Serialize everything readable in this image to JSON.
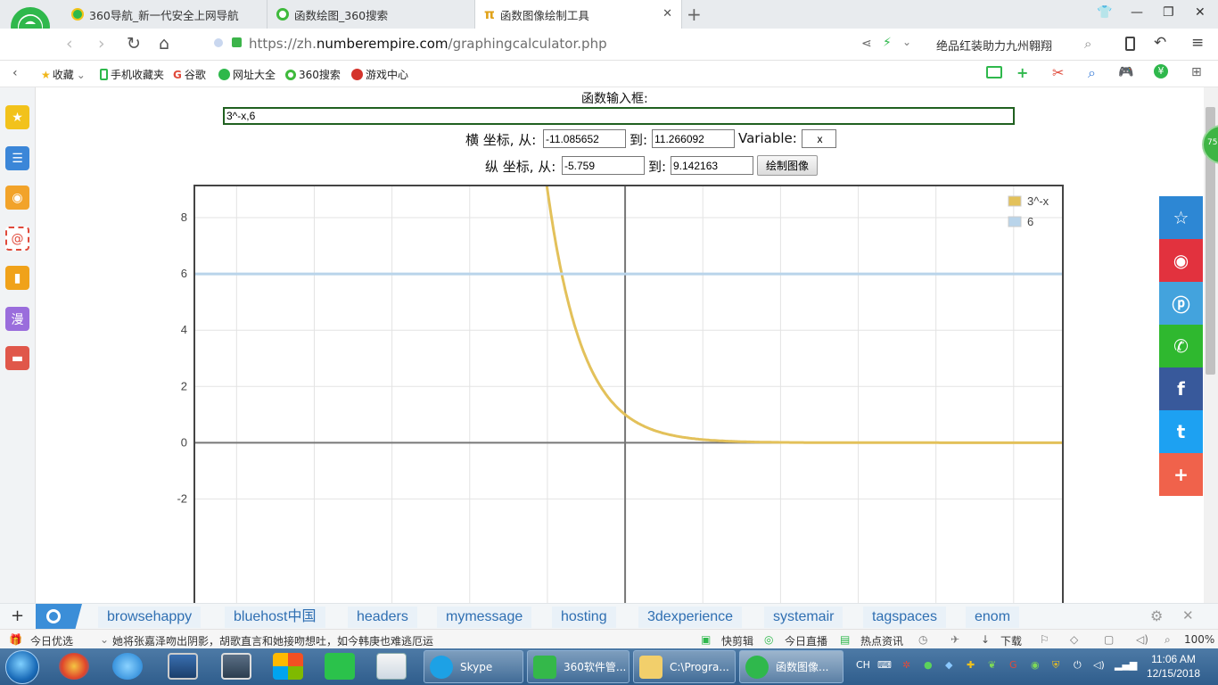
{
  "tabs": [
    {
      "title": "360导航_新一代安全上网导航",
      "active": false
    },
    {
      "title": "函数绘图_360搜索",
      "active": false
    },
    {
      "title": "函数图像绘制工具",
      "active": true
    }
  ],
  "address": {
    "url_prefix": "https://zh.",
    "url_domain": "numberempire.com",
    "url_path": "/graphingcalculator.php",
    "search_hint": "绝品红装助力九州翱翔"
  },
  "bookmarks": [
    "收藏",
    "手机收藏夹",
    "谷歌",
    "网址大全",
    "360搜索",
    "游戏中心"
  ],
  "form": {
    "func_label": "函数输入框:",
    "func_value": "3^-x,6",
    "x_label": "横 坐标, 从:",
    "x_from": "-11.085652",
    "to_label": "到:",
    "x_to": "11.266092",
    "variable_label": "Variable:",
    "variable_value": "x",
    "y_label": "纵 坐标, 从:",
    "y_from": "-5.759",
    "y_to": "9.142163",
    "plot_button": "绘制图像"
  },
  "chart_data": {
    "type": "line",
    "x_range": [
      -11.085652,
      11.266092
    ],
    "y_range": [
      -5.759,
      9.142163
    ],
    "y_ticks": [
      8,
      6,
      4,
      2,
      0,
      -2
    ],
    "grid": true,
    "legend_position": "top-right",
    "series": [
      {
        "name": "3^-x",
        "color": "#e3c15a",
        "function": "3^-x",
        "x": [
          -2,
          -1.5,
          -1,
          -0.5,
          0,
          0.5,
          1,
          1.5,
          2,
          3,
          4,
          6,
          8,
          11.27
        ],
        "y": [
          9,
          5.196,
          3,
          1.732,
          1,
          0.577,
          0.333,
          0.192,
          0.111,
          0.037,
          0.012,
          0.001,
          0.0002,
          0
        ]
      },
      {
        "name": "6",
        "color": "#b9d4ea",
        "function": "6",
        "x": [
          -11.085652,
          11.266092
        ],
        "y": [
          6,
          6
        ]
      }
    ]
  },
  "quick_links": [
    "browsehappy",
    "bluehost中国",
    "headers",
    "mymessage",
    "hosting",
    "3dexperience",
    "systemair",
    "tagspaces",
    "enom"
  ],
  "status": {
    "left_label": "今日优选",
    "news": "她将张嘉泽吻出阴影，胡歌直言和她接吻想吐，如今韩庚也难逃厄运",
    "items": [
      "快剪辑",
      "今日直播",
      "热点资讯",
      "下载"
    ],
    "zoom": "100%"
  },
  "taskbar": {
    "buttons": [
      "Skype",
      "360软件管...",
      "C:\\Progra...",
      "函数图像..."
    ],
    "tray_lang": "CH",
    "time": "11:06 AM",
    "date": "12/15/2018"
  },
  "badge": "75"
}
